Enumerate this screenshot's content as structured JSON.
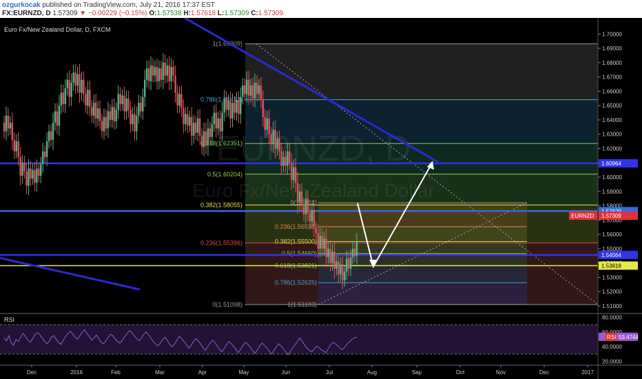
{
  "header": {
    "author": "ozgurkocak",
    "published_text": "published on TradingView.com, July 21, 2016 17:37 EST",
    "symbol": "FX:EURNZD, D",
    "last": "1.57309",
    "arrow": "▼",
    "change": "−0.00229 (−0.15%)",
    "o_label": "O:",
    "o_value": "1.57538",
    "h_label": "H:",
    "h_value": "1.57618",
    "l_label": "L:",
    "l_value": "1.57309",
    "c_label": "C:",
    "c_value": "1.57309"
  },
  "chart_title": "Euro Fx/New Zealand Dollar, D, FXCM",
  "watermark": {
    "line1": "EURNZD, D",
    "line2": "Euro Fx/New Zealand Dollar"
  },
  "colors": {
    "background": "#000000",
    "up_candle": "#53b987",
    "down_candle": "#eb4d5c",
    "trendline": "#2a2ad6",
    "hline_blue": "#2f34e8",
    "hline_yellow": "#e9e94a",
    "arrow": "#ffffff",
    "rsi": "#9b59d0"
  },
  "chart_data": {
    "type": "candlestick",
    "ylim": [
      1.5047,
      1.7069
    ],
    "price_ticks": [
      "1.70000",
      "1.69000",
      "1.68000",
      "1.67000",
      "1.66000",
      "1.65000",
      "1.64000",
      "1.63000",
      "1.62000",
      "1.61000",
      "1.60000",
      "1.59000",
      "1.58000",
      "1.57000",
      "1.56000",
      "1.55000",
      "1.54000",
      "1.53000",
      "1.52000",
      "1.51000"
    ],
    "x_labels": [
      "Dec",
      "2016",
      "Feb",
      "Mar",
      "Apr",
      "May",
      "Jun",
      "Jul",
      "Aug",
      "Sep",
      "Oct",
      "Nov",
      "Dec",
      "2017"
    ],
    "price_labels": [
      {
        "value": 1.60964,
        "text": "1.60964",
        "bg": "#2f34e8",
        "fg": "#ffffff"
      },
      {
        "value": 1.57629,
        "text": "1.57629",
        "bg": "#2f6fd8",
        "fg": "#ffffff"
      },
      {
        "value": 1.57309,
        "text": "1.57309",
        "bg": "#e0323c",
        "fg": "#ffffff"
      },
      {
        "value": 1.54564,
        "text": "1.54564",
        "bg": "#2f34e8",
        "fg": "#ffffff"
      },
      {
        "value": 1.53818,
        "text": "1.53818",
        "bg": "#e9e94a",
        "fg": "#000000"
      }
    ],
    "symbol_tag": "EURNZD",
    "fib_left": {
      "levels": [
        {
          "label": "1(1.69309)",
          "value": 1.69309,
          "color": "#9a9a9a"
        },
        {
          "label": "0.786(1.65412)",
          "value": 1.65412,
          "color": "#4aa3d6"
        },
        {
          "label": "0.618(1.62351)",
          "value": 1.62351,
          "color": "#7fcf6a"
        },
        {
          "label": "0.5(1.60204)",
          "value": 1.60204,
          "color": "#9fd04a"
        },
        {
          "label": "0.382(1.58055)",
          "value": 1.58055,
          "color": "#e0e04a"
        },
        {
          "label": "0.236(1.55396)",
          "value": 1.55396,
          "color": "#e04a4a"
        },
        {
          "label": "0(1.51098)",
          "value": 1.51098,
          "color": "#9a9a9a"
        }
      ]
    },
    "fib_right": {
      "levels": [
        {
          "label": "0(1.5821)",
          "value": 1.5821,
          "color": "#9a9a9a"
        },
        {
          "label": "0.236(1.56538)",
          "value": 1.56538,
          "color": "#e08a4a"
        },
        {
          "label": "0.382(1.55500)",
          "value": 1.555,
          "color": "#e0e04a"
        },
        {
          "label": "0.5(1.54660)",
          "value": 1.5466,
          "color": "#9fd04a"
        },
        {
          "label": "0.618(1.53821)",
          "value": 1.53821,
          "color": "#7fcf6a"
        },
        {
          "label": "0.786(1.52625)",
          "value": 1.52625,
          "color": "#4aa3d6"
        },
        {
          "label": "1(1.51103)",
          "value": 1.51103,
          "color": "#9a9a9a"
        }
      ]
    },
    "horizontal_lines": [
      {
        "value": 1.60964,
        "color": "#2f34e8"
      },
      {
        "value": 1.57629,
        "color": "#2f6fd8"
      },
      {
        "value": 1.54564,
        "color": "#2f34e8"
      },
      {
        "value": 1.53818,
        "color": "#e9e94a"
      }
    ],
    "candles_start": 1.638,
    "candles": [
      {
        "d": -0.006,
        "r": 0.014
      },
      {
        "d": 0.011,
        "r": 0.018
      },
      {
        "d": -0.009,
        "r": 0.016
      },
      {
        "d": 0.004,
        "r": 0.013
      },
      {
        "d": -0.012,
        "r": 0.02
      },
      {
        "d": -0.008,
        "r": 0.015
      },
      {
        "d": 0.007,
        "r": 0.014
      },
      {
        "d": -0.011,
        "r": 0.018
      },
      {
        "d": -0.013,
        "r": 0.02
      },
      {
        "d": 0.009,
        "r": 0.016
      },
      {
        "d": -0.006,
        "r": 0.014
      },
      {
        "d": -0.01,
        "r": 0.017
      },
      {
        "d": 0.012,
        "r": 0.019
      },
      {
        "d": -0.007,
        "r": 0.015
      },
      {
        "d": 0.006,
        "r": 0.013
      },
      {
        "d": -0.009,
        "r": 0.016
      },
      {
        "d": 0.01,
        "r": 0.018
      },
      {
        "d": -0.005,
        "r": 0.013
      },
      {
        "d": 0.008,
        "r": 0.015
      },
      {
        "d": 0.009,
        "r": 0.017
      },
      {
        "d": -0.004,
        "r": 0.012
      },
      {
        "d": 0.011,
        "r": 0.018
      },
      {
        "d": 0.007,
        "r": 0.014
      },
      {
        "d": -0.006,
        "r": 0.014
      },
      {
        "d": 0.012,
        "r": 0.02
      },
      {
        "d": 0.008,
        "r": 0.016
      },
      {
        "d": -0.01,
        "r": 0.017
      },
      {
        "d": 0.014,
        "r": 0.021
      },
      {
        "d": 0.009,
        "r": 0.017
      },
      {
        "d": -0.008,
        "r": 0.016
      },
      {
        "d": 0.011,
        "r": 0.018
      },
      {
        "d": 0.006,
        "r": 0.014
      },
      {
        "d": -0.012,
        "r": 0.019
      },
      {
        "d": 0.01,
        "r": 0.018
      },
      {
        "d": 0.007,
        "r": 0.016
      },
      {
        "d": -0.009,
        "r": 0.017
      },
      {
        "d": 0.008,
        "r": 0.015
      },
      {
        "d": -0.013,
        "r": 0.02
      },
      {
        "d": 0.009,
        "r": 0.016
      },
      {
        "d": -0.01,
        "r": 0.017
      },
      {
        "d": -0.008,
        "r": 0.015
      },
      {
        "d": 0.011,
        "r": 0.018
      },
      {
        "d": -0.012,
        "r": 0.019
      },
      {
        "d": -0.006,
        "r": 0.014
      },
      {
        "d": 0.009,
        "r": 0.016
      },
      {
        "d": -0.011,
        "r": 0.018
      },
      {
        "d": 0.007,
        "r": 0.015
      },
      {
        "d": -0.009,
        "r": 0.016
      },
      {
        "d": -0.007,
        "r": 0.014
      },
      {
        "d": 0.01,
        "r": 0.017
      },
      {
        "d": -0.008,
        "r": 0.015
      },
      {
        "d": 0.012,
        "r": 0.019
      },
      {
        "d": -0.006,
        "r": 0.014
      },
      {
        "d": 0.009,
        "r": 0.016
      },
      {
        "d": -0.01,
        "r": 0.017
      },
      {
        "d": 0.008,
        "r": 0.015
      },
      {
        "d": 0.011,
        "r": 0.018
      },
      {
        "d": -0.007,
        "r": 0.014
      },
      {
        "d": 0.006,
        "r": 0.013
      },
      {
        "d": -0.011,
        "r": 0.018
      },
      {
        "d": 0.009,
        "r": 0.016
      },
      {
        "d": -0.008,
        "r": 0.015
      },
      {
        "d": -0.01,
        "r": 0.017
      },
      {
        "d": 0.007,
        "r": 0.014
      },
      {
        "d": -0.012,
        "r": 0.019
      },
      {
        "d": 0.011,
        "r": 0.018
      },
      {
        "d": 0.009,
        "r": 0.016
      },
      {
        "d": -0.006,
        "r": 0.014
      },
      {
        "d": 0.01,
        "r": 0.017
      },
      {
        "d": 0.012,
        "r": 0.02
      },
      {
        "d": 0.008,
        "r": 0.015
      },
      {
        "d": -0.009,
        "r": 0.016
      },
      {
        "d": 0.011,
        "r": 0.018
      },
      {
        "d": -0.007,
        "r": 0.014
      },
      {
        "d": 0.006,
        "r": 0.013
      },
      {
        "d": -0.01,
        "r": 0.017
      },
      {
        "d": 0.009,
        "r": 0.016
      },
      {
        "d": -0.008,
        "r": 0.015
      },
      {
        "d": 0.012,
        "r": 0.019
      },
      {
        "d": -0.009,
        "r": 0.016
      },
      {
        "d": 0.007,
        "r": 0.014
      },
      {
        "d": -0.011,
        "r": 0.018
      },
      {
        "d": 0.01,
        "r": 0.017
      },
      {
        "d": -0.006,
        "r": 0.014
      },
      {
        "d": -0.012,
        "r": 0.02
      },
      {
        "d": -0.009,
        "r": 0.016
      },
      {
        "d": 0.008,
        "r": 0.015
      },
      {
        "d": -0.01,
        "r": 0.017
      },
      {
        "d": -0.011,
        "r": 0.018
      },
      {
        "d": 0.007,
        "r": 0.014
      },
      {
        "d": -0.008,
        "r": 0.015
      },
      {
        "d": 0.006,
        "r": 0.013
      },
      {
        "d": -0.013,
        "r": 0.02
      },
      {
        "d": 0.009,
        "r": 0.016
      },
      {
        "d": -0.007,
        "r": 0.014
      },
      {
        "d": 0.01,
        "r": 0.017
      },
      {
        "d": -0.012,
        "r": 0.019
      },
      {
        "d": -0.008,
        "r": 0.015
      },
      {
        "d": 0.011,
        "r": 0.018
      },
      {
        "d": -0.01,
        "r": 0.017
      },
      {
        "d": 0.012,
        "r": 0.02
      },
      {
        "d": -0.006,
        "r": 0.014
      },
      {
        "d": 0.009,
        "r": 0.016
      },
      {
        "d": 0.008,
        "r": 0.015
      },
      {
        "d": -0.011,
        "r": 0.018
      },
      {
        "d": 0.007,
        "r": 0.014
      },
      {
        "d": -0.009,
        "r": 0.016
      },
      {
        "d": 0.013,
        "r": 0.021
      },
      {
        "d": 0.01,
        "r": 0.017
      },
      {
        "d": -0.008,
        "r": 0.015
      },
      {
        "d": 0.006,
        "r": 0.013
      },
      {
        "d": -0.012,
        "r": 0.019
      },
      {
        "d": 0.011,
        "r": 0.018
      },
      {
        "d": -0.007,
        "r": 0.014
      },
      {
        "d": 0.009,
        "r": 0.016
      },
      {
        "d": -0.01,
        "r": 0.017
      },
      {
        "d": 0.012,
        "r": 0.019
      },
      {
        "d": 0.008,
        "r": 0.015
      },
      {
        "d": -0.006,
        "r": 0.014
      },
      {
        "d": 0.01,
        "r": 0.017
      },
      {
        "d": -0.011,
        "r": 0.018
      },
      {
        "d": 0.007,
        "r": 0.014
      },
      {
        "d": -0.009,
        "r": 0.016
      },
      {
        "d": 0.011,
        "r": 0.018
      },
      {
        "d": -0.008,
        "r": 0.015
      },
      {
        "d": 0.006,
        "r": 0.013
      },
      {
        "d": -0.01,
        "r": 0.017
      },
      {
        "d": -0.012,
        "r": 0.019
      },
      {
        "d": -0.009,
        "r": 0.016
      },
      {
        "d": 0.008,
        "r": 0.015
      },
      {
        "d": -0.011,
        "r": 0.018
      },
      {
        "d": -0.007,
        "r": 0.014
      },
      {
        "d": 0.01,
        "r": 0.017
      },
      {
        "d": -0.013,
        "r": 0.02
      },
      {
        "d": 0.007,
        "r": 0.014
      },
      {
        "d": -0.009,
        "r": 0.016
      },
      {
        "d": -0.01,
        "r": 0.017
      },
      {
        "d": 0.006,
        "r": 0.013
      },
      {
        "d": -0.006,
        "r": 0.014
      },
      {
        "d": 0.01,
        "r": 0.017
      },
      {
        "d": -0.008,
        "r": 0.015
      },
      {
        "d": -0.012,
        "r": 0.019
      },
      {
        "d": 0.009,
        "r": 0.016
      },
      {
        "d": -0.011,
        "r": 0.018
      },
      {
        "d": -0.014,
        "r": 0.022
      },
      {
        "d": 0.008,
        "r": 0.015
      },
      {
        "d": -0.009,
        "r": 0.016
      },
      {
        "d": -0.007,
        "r": 0.014
      },
      {
        "d": 0.011,
        "r": 0.018
      },
      {
        "d": -0.01,
        "r": 0.017
      },
      {
        "d": -0.006,
        "r": 0.013
      },
      {
        "d": 0.008,
        "r": 0.015
      },
      {
        "d": -0.012,
        "r": 0.019
      },
      {
        "d": -0.004,
        "r": 0.012
      },
      {
        "d": -0.011,
        "r": 0.018
      },
      {
        "d": 0.009,
        "r": 0.016
      },
      {
        "d": -0.009,
        "r": 0.016
      },
      {
        "d": 0.007,
        "r": 0.014
      },
      {
        "d": -0.013,
        "r": 0.02
      },
      {
        "d": 0.006,
        "r": 0.013
      },
      {
        "d": -0.01,
        "r": 0.017
      },
      {
        "d": 0.008,
        "r": 0.015
      },
      {
        "d": -0.012,
        "r": 0.02
      },
      {
        "d": 0.005,
        "r": 0.013
      },
      {
        "d": -0.009,
        "r": 0.016
      },
      {
        "d": 0.007,
        "r": 0.014
      },
      {
        "d": -0.011,
        "r": 0.018
      },
      {
        "d": 0.006,
        "r": 0.013
      },
      {
        "d": 0.009,
        "r": 0.016
      },
      {
        "d": -0.007,
        "r": 0.014
      },
      {
        "d": 0.008,
        "r": 0.015
      },
      {
        "d": 0.006,
        "r": 0.013
      },
      {
        "d": -0.005,
        "r": 0.012
      },
      {
        "d": 0.01,
        "r": 0.017
      }
    ],
    "rsi": {
      "label": "RSI",
      "value_text": "53.4744",
      "ticks": [
        "80.0000",
        "60.0000",
        "40.0000",
        "20.0000"
      ],
      "ylim": [
        15,
        85
      ],
      "values": [
        52,
        48,
        55,
        45,
        42,
        50,
        47,
        53,
        58,
        54,
        49,
        46,
        51,
        56,
        59,
        57,
        52,
        48,
        44,
        47,
        53,
        55,
        50,
        46,
        43,
        49,
        54,
        58,
        61,
        57,
        53,
        50,
        55,
        60,
        63,
        58,
        54,
        49,
        52,
        56,
        51,
        46,
        44,
        48,
        53,
        57,
        55,
        50,
        47,
        45,
        49,
        54,
        58,
        62,
        59,
        55,
        51,
        48,
        52,
        57,
        60,
        56,
        52,
        47,
        44,
        41,
        45,
        50,
        53,
        48,
        43,
        40,
        44,
        49,
        54,
        51,
        47,
        43,
        38,
        42,
        47,
        51,
        48,
        44,
        39,
        35,
        40,
        45,
        49,
        46,
        41,
        37,
        33,
        38,
        43,
        47,
        44,
        40,
        36,
        32,
        37,
        42,
        46,
        43,
        39,
        35,
        31,
        36,
        41,
        45,
        42,
        38,
        34,
        30,
        35,
        40,
        44,
        41,
        37,
        33,
        29,
        34,
        39,
        43,
        48,
        52,
        47,
        42,
        38,
        35,
        33,
        37,
        41,
        39,
        36,
        34,
        32,
        38,
        43,
        46,
        44,
        41,
        38,
        36,
        40,
        44,
        47,
        50,
        52,
        53
      ]
    }
  }
}
